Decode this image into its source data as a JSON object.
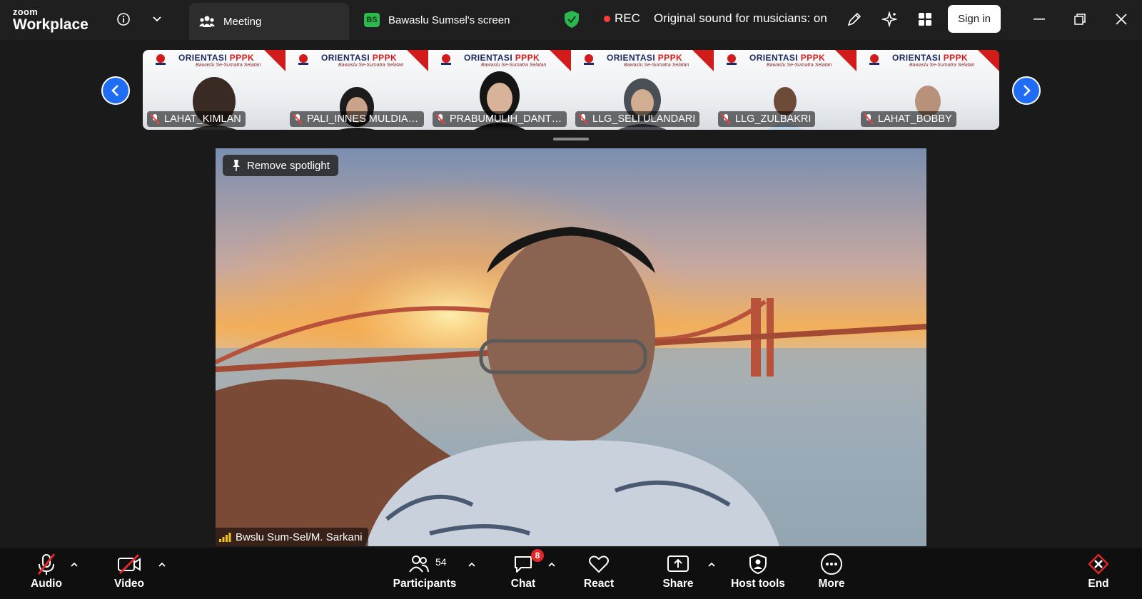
{
  "app": {
    "brand_small": "zoom",
    "brand_big": "Workplace"
  },
  "tabs": {
    "meeting": "Meeting",
    "screen_badge": "BS",
    "screen": "Bawaslu Sumsel's screen"
  },
  "status": {
    "rec": "REC",
    "original_sound": "Original sound for musicians: on",
    "signin": "Sign in"
  },
  "thumbnail_banner": {
    "title_a": "ORIENTASI ",
    "title_b": "PPPK",
    "subtitle": "Bawaslu Se-Sumatra Selatan"
  },
  "participants": [
    {
      "name": "LAHAT_KIMLAN"
    },
    {
      "name": "PALI_INNES MULDIAN..."
    },
    {
      "name": "PRABUMULIH_DANTI ..."
    },
    {
      "name": "LLG_SELI ULANDARI"
    },
    {
      "name": "LLG_ZULBAKRI"
    },
    {
      "name": "LAHAT_BOBBY"
    }
  ],
  "spotlight": {
    "remove_label": "Remove spotlight",
    "speaker": "Bwslu Sum-Sel/M. Sarkani"
  },
  "toolbar": {
    "audio": "Audio",
    "video": "Video",
    "participants": "Participants",
    "participants_count": "54",
    "chat": "Chat",
    "chat_badge": "8",
    "react": "React",
    "share": "Share",
    "host_tools": "Host tools",
    "more": "More",
    "end": "End"
  },
  "colors": {
    "accent_blue": "#1f6cf5",
    "rec_red": "#ff3b3b",
    "end_red": "#e02828",
    "secure_green": "#2db84f"
  }
}
